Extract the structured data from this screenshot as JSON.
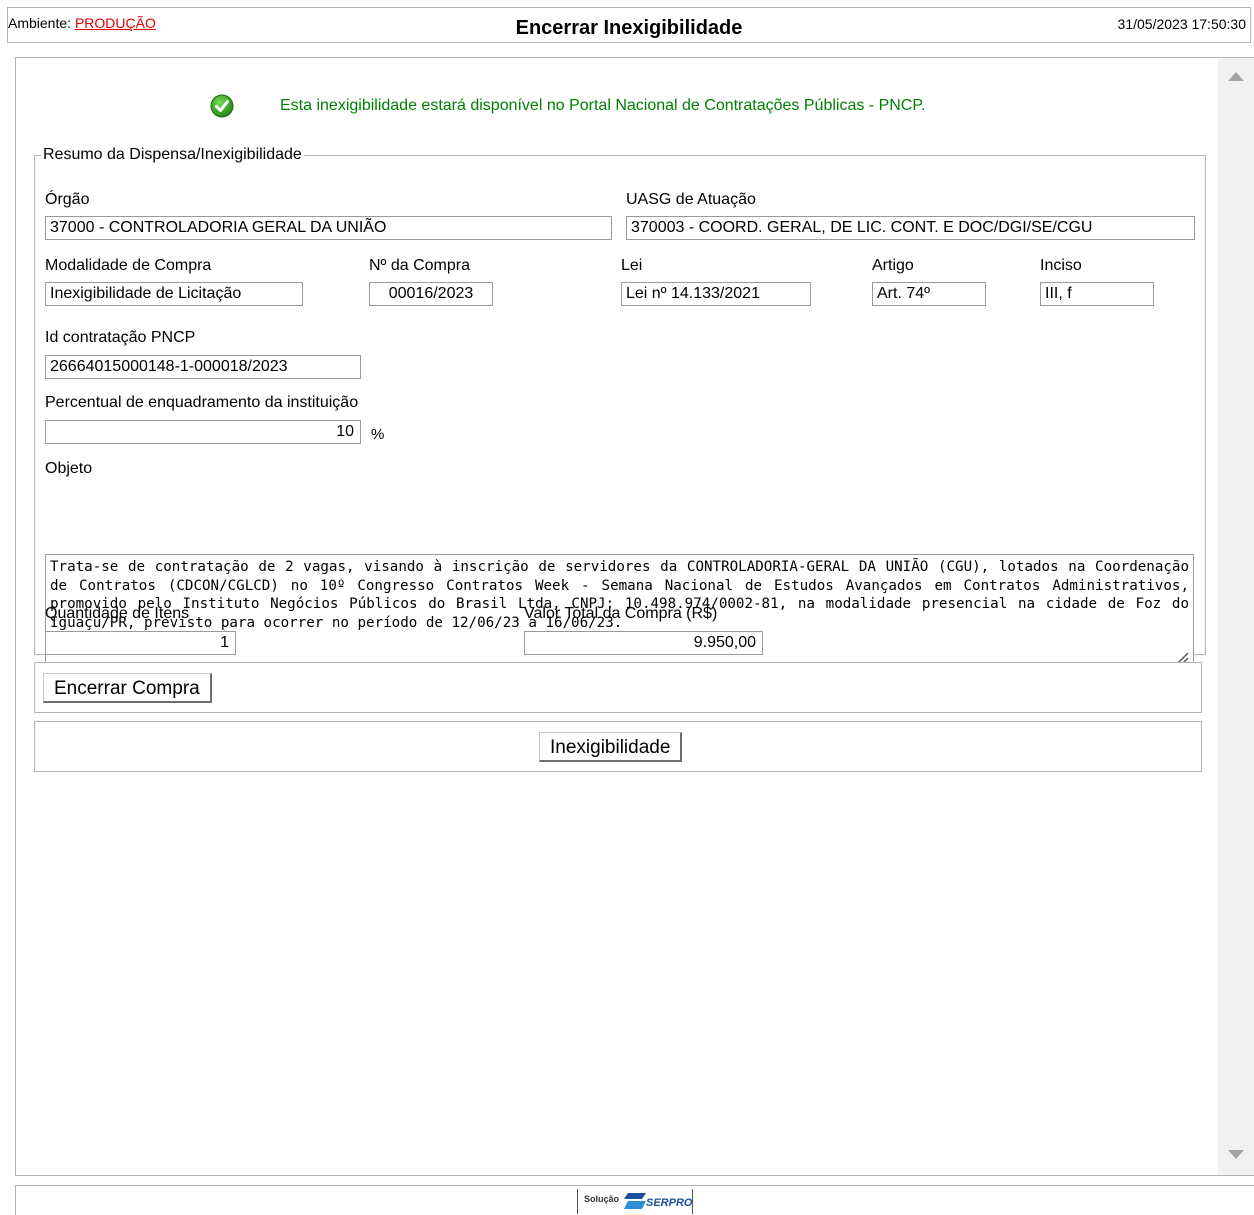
{
  "header": {
    "env_label": "Ambiente:",
    "env_value": "PRODUÇÃO",
    "title": "Encerrar Inexigibilidade",
    "datetime": "31/05/2023 17:50:30"
  },
  "notice": {
    "text": "Esta inexigibilidade estará disponível no Portal Nacional de Contratações Públicas - PNCP."
  },
  "resumo": {
    "legend": "Resumo da Dispensa/Inexigibilidade",
    "orgao_label": "Órgão",
    "orgao_value": "37000 - CONTROLADORIA GERAL DA UNIÃO",
    "uasg_label": "UASG de Atuação",
    "uasg_value": "370003 - COORD. GERAL, DE LIC. CONT. E DOC/DGI/SE/CGU",
    "modalidade_label": "Modalidade de Compra",
    "modalidade_value": "Inexigibilidade de Licitação",
    "numero_label": "Nº da Compra",
    "numero_value": "00016/2023",
    "lei_label": "Lei",
    "lei_value": "Lei nº 14.133/2021",
    "artigo_label": "Artigo",
    "artigo_value": "Art. 74º",
    "inciso_label": "Inciso",
    "inciso_value": "III, f",
    "pncp_label": "Id contratação PNCP",
    "pncp_value": "26664015000148-1-000018/2023",
    "percentual_label": "Percentual de enquadramento da instituição",
    "percentual_value": "10",
    "percentual_unit": "%",
    "objeto_label": "Objeto",
    "objeto_value": "Trata-se de contratação de 2 vagas, visando à inscrição de servidores da CONTROLADORIA-GERAL DA UNIÃO (CGU), lotados na Coordenação de Contratos (CDCON/CGLCD) no 10º Congresso Contratos Week - Semana Nacional de Estudos Avançados em Contratos Administrativos, promovido pelo Instituto Negócios Públicos do Brasil Ltda, CNPJ: 10.498.974/0002-81, na modalidade presencial na cidade de Foz do Iguaçu/PR, previsto para ocorrer no período de 12/06/23 a 16/06/23.",
    "quantidade_label": "Quantidade de Itens",
    "quantidade_value": "1",
    "valor_label": "Valor Total da Compra (R$)",
    "valor_value": "9.950,00"
  },
  "actions": {
    "encerrar_label": "Encerrar Compra",
    "inexigibilidade_label": "Inexigibilidade"
  },
  "footer": {
    "logo_prefix": "Solução",
    "logo_brand": "SERPRO"
  },
  "colors": {
    "env_value": "#e00000",
    "notice_text": "#008000",
    "serpro_blue": "#1b4f9c"
  }
}
